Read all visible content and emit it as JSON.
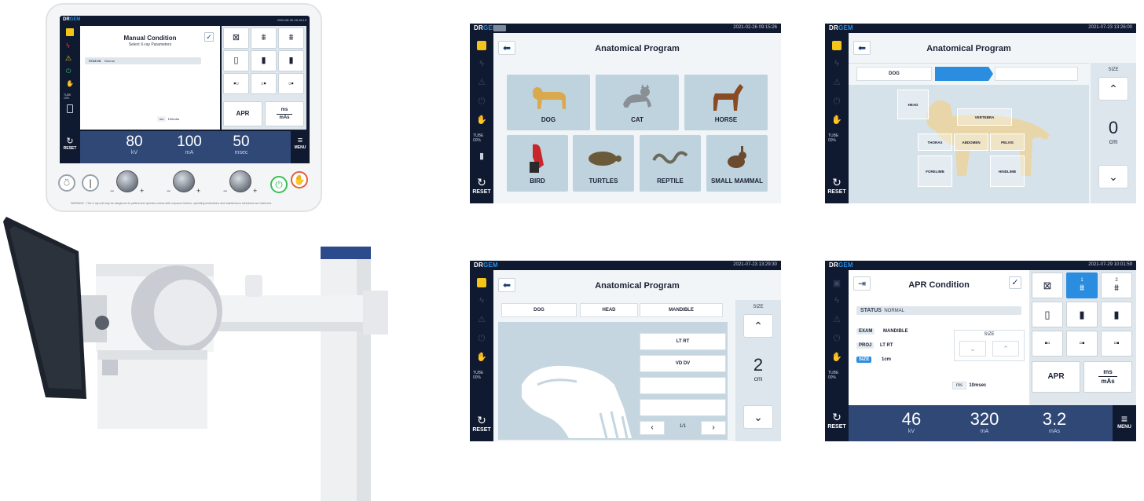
{
  "brand": {
    "dr": "DR",
    "gem": "GEM"
  },
  "colors": {
    "accent": "#2a8de0",
    "navy": "#0f1930",
    "panel": "#2f4876",
    "warning_yellow": "#f4c518"
  },
  "device": {
    "timestamp": "2020-06-30 16:18:19",
    "title": "Manual Condition",
    "subtitle": "Select X-ray Parameters",
    "status_label": "STATUS",
    "status_value": "Normal",
    "ms_label": "ms",
    "ms_value": "100mAs",
    "apr_label": "APR",
    "ms_top": "ms",
    "mas_bottom": "mAs",
    "reset": "RESET",
    "menu": "MENU",
    "tube_label": "TUBE",
    "tube_value": "10%",
    "readouts": [
      {
        "value": "80",
        "unit": "kV"
      },
      {
        "value": "100",
        "unit": "mA"
      },
      {
        "value": "50",
        "unit": "msec"
      }
    ],
    "minus": "−",
    "plus": "+",
    "warning": "WARNING : This X-ray unit may be dangerous to patient and operator unless safe exposure factors, operating instructions and maintenance schedules are observed."
  },
  "screen1": {
    "timestamp": "2021-02-26 09:15:26",
    "title": "Anatomical Program",
    "reset": "RESET",
    "tube_label": "TUBE",
    "tube_value": "00%",
    "tiles": [
      {
        "label": "DOG",
        "icon": "dog-icon"
      },
      {
        "label": "CAT",
        "icon": "cat-icon"
      },
      {
        "label": "HORSE",
        "icon": "horse-icon"
      },
      {
        "label": "BIRD",
        "icon": "bird-icon"
      },
      {
        "label": "TURTLES",
        "icon": "turtle-icon"
      },
      {
        "label": "REPTILE",
        "icon": "snake-icon"
      },
      {
        "label": "SMALL MAMMAL",
        "icon": "rabbit-icon"
      }
    ]
  },
  "screen2": {
    "timestamp": "2021-07-23 13:26:00",
    "title": "Anatomical Program",
    "reset": "RESET",
    "tube_label": "TUBE",
    "tube_value": "00%",
    "crumb": "DOG",
    "size_label": "SIZE",
    "size_value": "0",
    "size_unit": "cm",
    "regions": [
      "HEAD",
      "VERTEBRA",
      "THORAX",
      "ABDOMEN",
      "PELVIS",
      "FORELIMB",
      "HINDLIMB"
    ]
  },
  "screen3": {
    "timestamp": "2021-07-23 13:29:30",
    "title": "Anatomical Program",
    "reset": "RESET",
    "tube_label": "TUBE",
    "tube_value": "00%",
    "crumbs": [
      "DOG",
      "HEAD",
      "MANDIBLE"
    ],
    "size_label": "SIZE",
    "size_value": "2",
    "size_unit": "cm",
    "projections": [
      "LT RT",
      "VD DV",
      "",
      ""
    ],
    "page": "1/1"
  },
  "screen4": {
    "timestamp": "2021-07-29 10:01:59",
    "title": "APR Condition",
    "reset": "RESET",
    "tube_label": "TUBE",
    "tube_value": "00%",
    "status_label": "STATUS",
    "status_value": "NORMAL",
    "exam_label": "EXAM",
    "exam_value": "MANDIBLE",
    "proj_label": "PROJ",
    "proj_value": "LT RT",
    "size_tag": "SIZE",
    "size_value": "1cm",
    "size_box_label": "SIZE",
    "ms_label": "ms",
    "ms_value": "10msec",
    "apr_label": "APR",
    "ms_top": "ms",
    "mas_bottom": "mAs",
    "grid_num1": "1",
    "grid_num2": "2",
    "menu": "MENU",
    "readouts": [
      {
        "value": "46",
        "unit": "kV"
      },
      {
        "value": "320",
        "unit": "mA"
      },
      {
        "value": "3.2",
        "unit": "mAs"
      }
    ]
  }
}
